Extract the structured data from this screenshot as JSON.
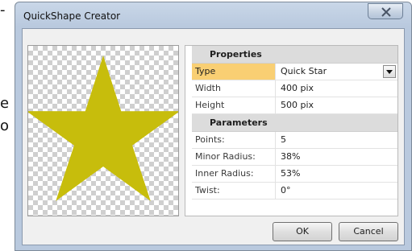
{
  "window": {
    "title": "QuickShape Creator"
  },
  "background": {
    "fragments": [
      "-",
      "e",
      "o"
    ]
  },
  "preview": {
    "shape": "star",
    "fill_color": "#c7bd0c"
  },
  "properties": {
    "section_label": "Properties",
    "rows": [
      {
        "name": "Type",
        "value": "Quick Star",
        "selected": true
      },
      {
        "name": "Width",
        "value": "400 pix"
      },
      {
        "name": "Height",
        "value": "500 pix"
      }
    ]
  },
  "parameters": {
    "section_label": "Parameters",
    "rows": [
      {
        "name": "Points:",
        "value": "5"
      },
      {
        "name": "Minor Radius:",
        "value": "38%"
      },
      {
        "name": "Inner Radius:",
        "value": "53%"
      },
      {
        "name": "Twist:",
        "value": "0°"
      }
    ]
  },
  "buttons": {
    "ok_label": "OK",
    "cancel_label": "Cancel"
  },
  "colors": {
    "selected_row": "#f9cf73",
    "section_header": "#dcdcdc",
    "window_frame": "#b9c9de"
  }
}
